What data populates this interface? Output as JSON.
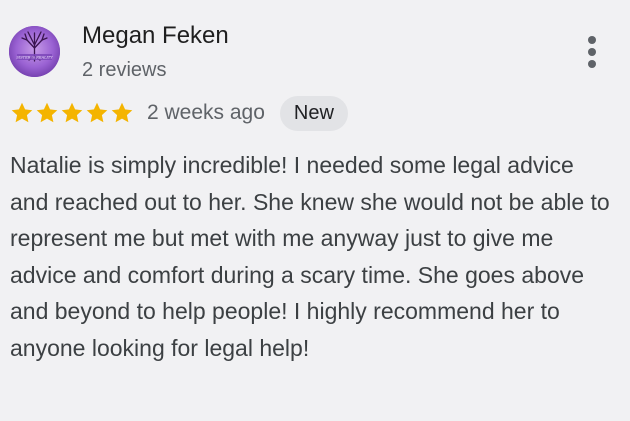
{
  "review": {
    "author": {
      "name": "Megan Feken",
      "meta": "2 reviews",
      "avatar_text": "SISTER in REALITY",
      "avatar_color": "#8a55c9"
    },
    "menu_icon": "more-vert-icon",
    "rating": 5,
    "rating_max": 5,
    "star_color": "#f4b400",
    "time_ago": "2 weeks ago",
    "badge": "New",
    "text": "Natalie is simply incredible! I needed some legal advice and reached out to her. She knew she would not be able to represent me but met with me anyway just to give me advice and comfort during a scary time. She goes above and beyond to help people! I highly recommend her to anyone looking for legal help!"
  }
}
